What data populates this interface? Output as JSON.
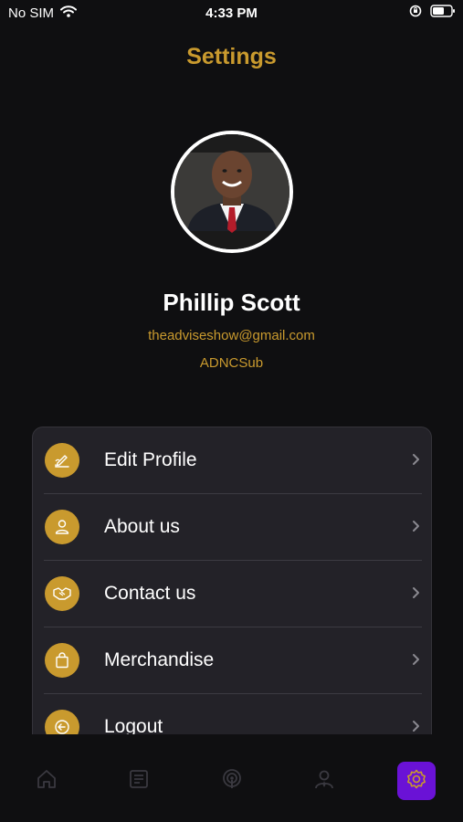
{
  "status": {
    "carrier": "No SIM",
    "time": "4:33 PM"
  },
  "header": {
    "title": "Settings"
  },
  "profile": {
    "name": "Phillip Scott",
    "email": "theadviseshow@gmail.com",
    "role": "ADNCSub"
  },
  "menu": {
    "items": [
      {
        "label": "Edit Profile",
        "icon": "edit-profile-icon"
      },
      {
        "label": "About us",
        "icon": "person-icon"
      },
      {
        "label": "Contact us",
        "icon": "handshake-icon"
      },
      {
        "label": "Merchandise",
        "icon": "shopping-bag-icon"
      },
      {
        "label": "Logout",
        "icon": "logout-icon"
      }
    ]
  },
  "tabbar": {
    "tabs": [
      {
        "icon": "home-icon",
        "active": false
      },
      {
        "icon": "news-icon",
        "active": false
      },
      {
        "icon": "podcast-icon",
        "active": false
      },
      {
        "icon": "advisor-icon",
        "active": false
      },
      {
        "icon": "gear-icon",
        "active": true
      }
    ]
  },
  "colors": {
    "accent": "#c99a2e",
    "background": "#0f0f11",
    "card": "#232228",
    "active_tab": "#6a12d6"
  }
}
